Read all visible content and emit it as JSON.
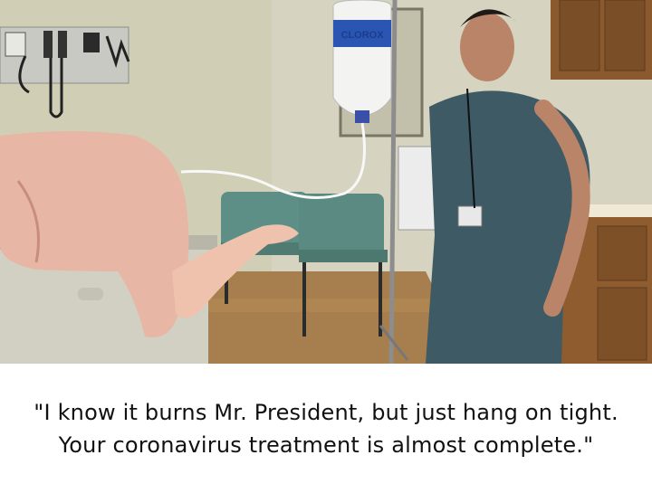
{
  "caption": "\"I know it burns Mr. President, but just hang on tight. Your coronavirus treatment is almost complete.\"",
  "bottle_label": "CLOROX",
  "palette": {
    "wall": "#d8d6c2",
    "floor": "#a9804e",
    "scrubs": "#3e5a64",
    "cabinet": "#8a5a2e",
    "chair": "#5d8f86",
    "skin": "#e8b6a4"
  }
}
